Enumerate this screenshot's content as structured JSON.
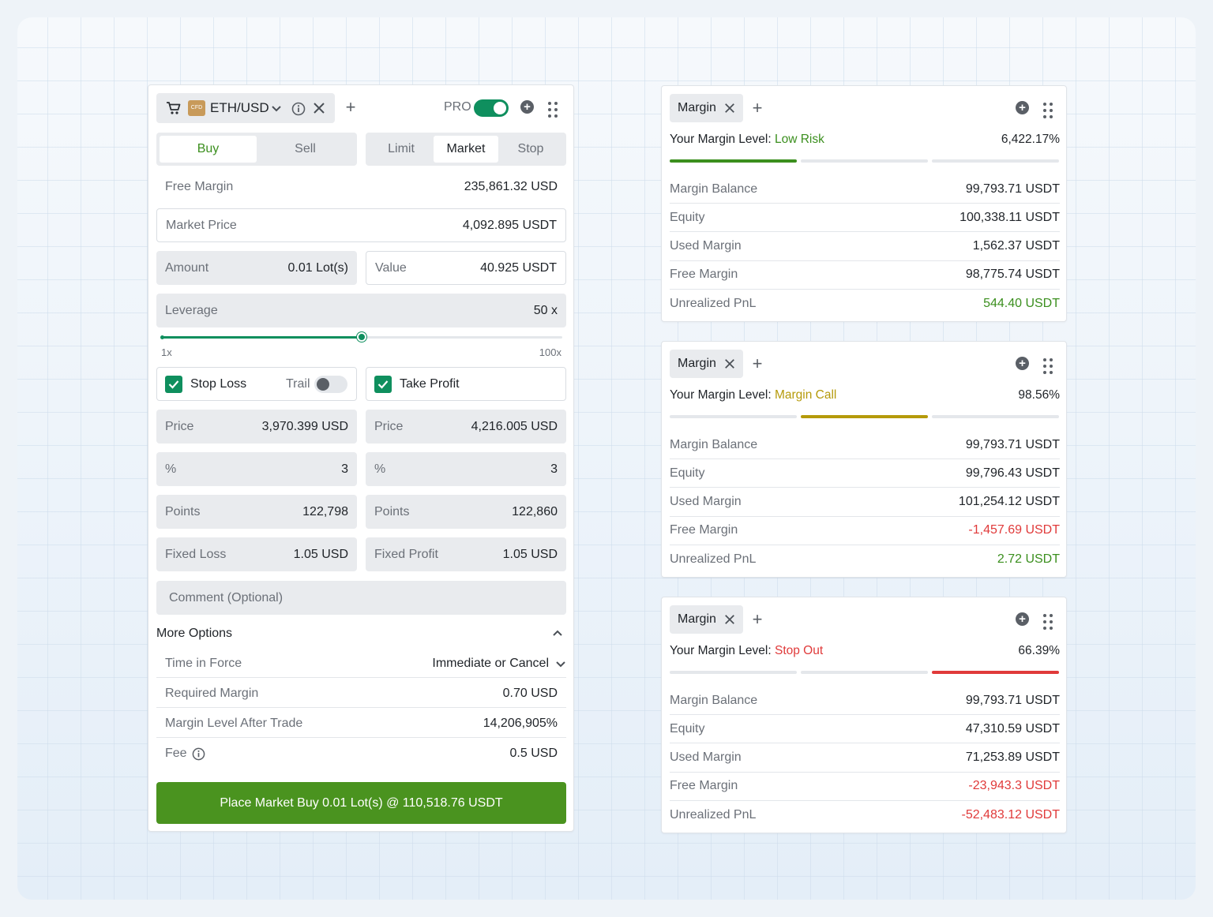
{
  "colors": {
    "accent_green": "#0f8f5e",
    "buy_green": "#4a931f",
    "positive": "#3b8f1e",
    "negative": "#e03a3a",
    "warning": "#b59a0a",
    "bar_inactive": "#e4e7eb"
  },
  "order": {
    "symbol_tag": {
      "cart_icon": "cart-icon",
      "badge": "CFD",
      "symbol": "ETH/USD",
      "chevron_icon": "chevron-down-icon",
      "info_icon": "info-icon",
      "close_icon": "close-icon"
    },
    "add_label": "+",
    "pro_label": "PRO",
    "pro_enabled": true,
    "side_tabs": [
      {
        "label": "Buy",
        "active": true
      },
      {
        "label": "Sell",
        "active": false
      }
    ],
    "type_tabs": [
      {
        "label": "Limit",
        "active": false
      },
      {
        "label": "Market",
        "active": true
      },
      {
        "label": "Stop",
        "active": false
      }
    ],
    "free_margin": {
      "label": "Free Margin",
      "value": "235,861.32 USD"
    },
    "market_price": {
      "label": "Market Price",
      "value": "4,092.895 USDT"
    },
    "amount": {
      "label": "Amount",
      "value": "0.01 Lot(s)"
    },
    "value": {
      "label": "Value",
      "value": "40.925 USDT"
    },
    "leverage": {
      "label": "Leverage",
      "value": "50 x",
      "min_label": "1x",
      "max_label": "100x",
      "fraction": 0.5
    },
    "stop_loss": {
      "label": "Stop Loss",
      "checked": true,
      "trail_label": "Trail",
      "trail_enabled": false,
      "price_label": "Price",
      "price_value": "3,970.399 USD",
      "pct_label": "%",
      "pct_value": "3",
      "points_label": "Points",
      "points_value": "122,798",
      "fixed_label": "Fixed Loss",
      "fixed_value": "1.05 USD"
    },
    "take_profit": {
      "label": "Take Profit",
      "checked": true,
      "price_label": "Price",
      "price_value": "4,216.005 USD",
      "pct_label": "%",
      "pct_value": "3",
      "points_label": "Points",
      "points_value": "122,860",
      "fixed_label": "Fixed Profit",
      "fixed_value": "1.05 USD"
    },
    "comment_placeholder": "Comment (Optional)",
    "more_options": {
      "label": "More Options",
      "rows": [
        {
          "label": "Time in Force",
          "value": "Immediate or Cancel"
        },
        {
          "label": "Required Margin",
          "value": "0.70 USD"
        },
        {
          "label": "Margin Level After Trade",
          "value": "14,206,905%"
        },
        {
          "label": "Fee",
          "value": "0.5 USD"
        }
      ]
    },
    "place_button": "Place Market Buy 0.01 Lot(s) @ 110,518.76 USDT"
  },
  "margin_panels": [
    {
      "tab_label": "Margin",
      "level_label": "Your Margin Level:",
      "level_status": "Low Risk",
      "level_status_color": "positive",
      "level_value": "6,422.17%",
      "active_segment": 0,
      "rows": [
        {
          "label": "Margin Balance",
          "value": "99,793.71 USDT",
          "tone": "normal"
        },
        {
          "label": "Equity",
          "value": "100,338.11 USDT",
          "tone": "normal"
        },
        {
          "label": "Used Margin",
          "value": "1,562.37 USDT",
          "tone": "normal"
        },
        {
          "label": "Free Margin",
          "value": "98,775.74 USDT",
          "tone": "normal"
        },
        {
          "label": "Unrealized PnL",
          "value": "544.40 USDT",
          "tone": "positive"
        }
      ]
    },
    {
      "tab_label": "Margin",
      "level_label": "Your Margin Level:",
      "level_status": "Margin Call",
      "level_status_color": "warning",
      "level_value": "98.56%",
      "active_segment": 1,
      "rows": [
        {
          "label": "Margin Balance",
          "value": "99,793.71 USDT",
          "tone": "normal"
        },
        {
          "label": "Equity",
          "value": "99,796.43 USDT",
          "tone": "normal"
        },
        {
          "label": "Used Margin",
          "value": "101,254.12 USDT",
          "tone": "normal"
        },
        {
          "label": "Free Margin",
          "value": "-1,457.69 USDT",
          "tone": "negative"
        },
        {
          "label": "Unrealized PnL",
          "value": "2.72 USDT",
          "tone": "positive"
        }
      ]
    },
    {
      "tab_label": "Margin",
      "level_label": "Your Margin Level:",
      "level_status": "Stop Out",
      "level_status_color": "negative",
      "level_value": "66.39%",
      "active_segment": 2,
      "rows": [
        {
          "label": "Margin Balance",
          "value": "99,793.71 USDT",
          "tone": "normal"
        },
        {
          "label": "Equity",
          "value": "47,310.59 USDT",
          "tone": "normal"
        },
        {
          "label": "Used Margin",
          "value": "71,253.89 USDT",
          "tone": "normal"
        },
        {
          "label": "Free Margin",
          "value": "-23,943.3 USDT",
          "tone": "negative"
        },
        {
          "label": "Unrealized PnL",
          "value": "-52,483.12 USDT",
          "tone": "negative"
        }
      ]
    }
  ]
}
